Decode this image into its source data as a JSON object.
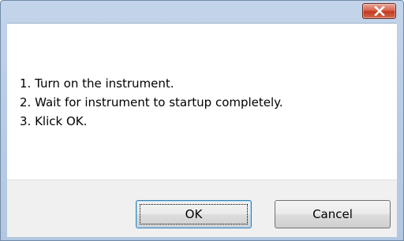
{
  "dialog": {
    "title": "",
    "close_icon": "close-x-icon",
    "messages": [
      "1. Turn on the instrument.",
      "2. Wait for instrument to startup completely.",
      "3. Klick OK."
    ],
    "buttons": {
      "ok_label": "OK",
      "cancel_label": "Cancel"
    }
  },
  "colors": {
    "titlebar": "#b9cde6",
    "close_button": "#c7432a",
    "content_background": "#ffffff",
    "button_area_background": "#f0f0f0",
    "default_button_border": "#3c7fb1"
  }
}
